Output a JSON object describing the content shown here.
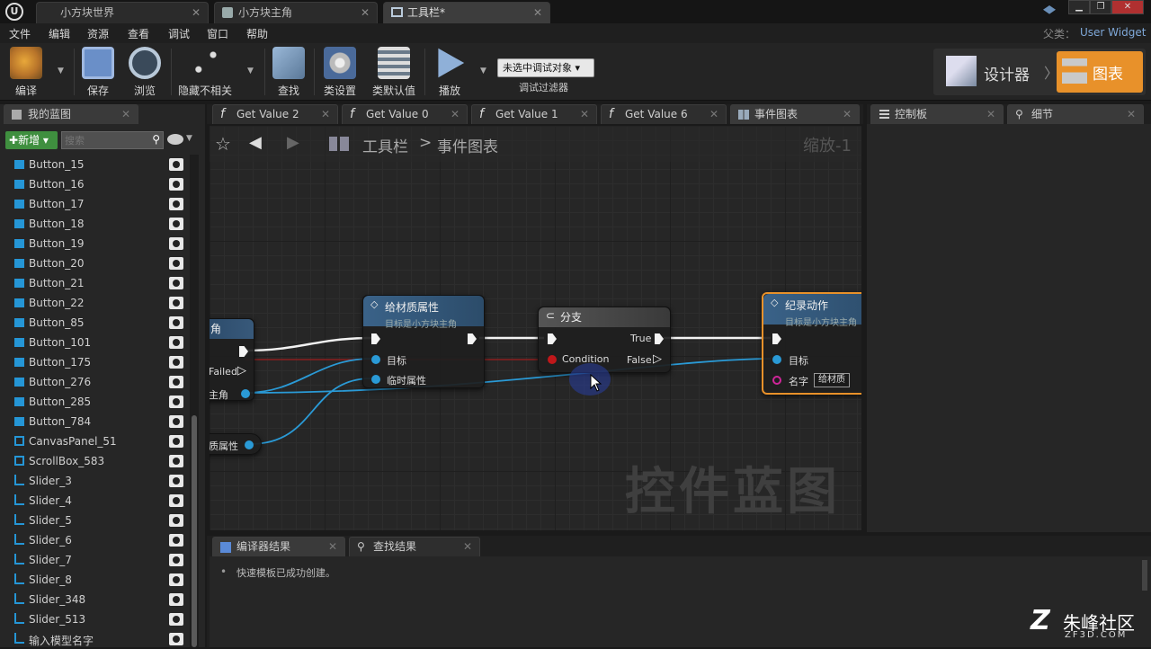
{
  "tabs": [
    {
      "label": "小方块世界"
    },
    {
      "label": "小方块主角"
    },
    {
      "label": "工具栏*"
    }
  ],
  "menu": [
    "文件",
    "编辑",
    "资源",
    "查看",
    "调试",
    "窗口",
    "帮助"
  ],
  "parent": {
    "label": "父类：",
    "value": "User Widget"
  },
  "toolbar": {
    "compile": "编译",
    "save": "保存",
    "browse": "浏览",
    "hide_unrelated": "隐藏不相关",
    "find": "查找",
    "class_settings": "类设置",
    "class_defaults": "类默认值",
    "play": "播放",
    "debug_select": "未选中调试对象",
    "debug_filter": "调试过滤器"
  },
  "mode": {
    "designer": "设计器",
    "graph": "图表"
  },
  "left_panel": {
    "tab": "我的蓝图",
    "new_button": "新增",
    "search_placeholder": "搜索",
    "items": [
      {
        "label": "Button_15",
        "type": "button"
      },
      {
        "label": "Button_16",
        "type": "button"
      },
      {
        "label": "Button_17",
        "type": "button"
      },
      {
        "label": "Button_18",
        "type": "button"
      },
      {
        "label": "Button_19",
        "type": "button"
      },
      {
        "label": "Button_20",
        "type": "button"
      },
      {
        "label": "Button_21",
        "type": "button"
      },
      {
        "label": "Button_22",
        "type": "button"
      },
      {
        "label": "Button_85",
        "type": "button"
      },
      {
        "label": "Button_101",
        "type": "button"
      },
      {
        "label": "Button_175",
        "type": "button"
      },
      {
        "label": "Button_276",
        "type": "button"
      },
      {
        "label": "Button_285",
        "type": "button"
      },
      {
        "label": "Button_784",
        "type": "button"
      },
      {
        "label": "CanvasPanel_51",
        "type": "panel"
      },
      {
        "label": "ScrollBox_583",
        "type": "panel"
      },
      {
        "label": "Slider_3",
        "type": "slider"
      },
      {
        "label": "Slider_4",
        "type": "slider"
      },
      {
        "label": "Slider_5",
        "type": "slider"
      },
      {
        "label": "Slider_6",
        "type": "slider"
      },
      {
        "label": "Slider_7",
        "type": "slider"
      },
      {
        "label": "Slider_8",
        "type": "slider"
      },
      {
        "label": "Slider_348",
        "type": "slider"
      },
      {
        "label": "Slider_513",
        "type": "slider"
      },
      {
        "label": "输入模型名字",
        "type": "slider"
      }
    ]
  },
  "graph_tabs": [
    {
      "label": "Get Value 2"
    },
    {
      "label": "Get Value 0"
    },
    {
      "label": "Get Value 1"
    },
    {
      "label": "Get Value 6"
    },
    {
      "label": "事件图表"
    }
  ],
  "right_tabs": [
    {
      "label": "控制板"
    },
    {
      "label": "细节"
    }
  ],
  "graph": {
    "breadcrumb_root": "工具栏",
    "breadcrumb_sep": ">",
    "breadcrumb_leaf": "事件图表",
    "zoom": "缩放-1",
    "watermark": "控件蓝图",
    "nodes": {
      "left_partial": {
        "title": "角",
        "failed": "Failed",
        "pin": "主角"
      },
      "mat_prop": {
        "title": "给材质属性",
        "subtitle": "目标是小方块主角",
        "target": "目标",
        "temp": "临时属性"
      },
      "branch": {
        "title": "分支",
        "condition": "Condition",
        "true": "True",
        "false": "False"
      },
      "record": {
        "title": "纪录动作",
        "subtitle": "目标是小方块主角",
        "target": "目标",
        "name_label": "名字",
        "name_value": "给材质"
      },
      "var": {
        "label": "质属性"
      }
    }
  },
  "bottom": {
    "tabs": [
      {
        "label": "编译器结果"
      },
      {
        "label": "查找结果"
      }
    ],
    "message": "快速模板已成功创建。"
  },
  "watermark_brand": {
    "text": "朱峰社区",
    "url": "ZF3D.COM"
  }
}
